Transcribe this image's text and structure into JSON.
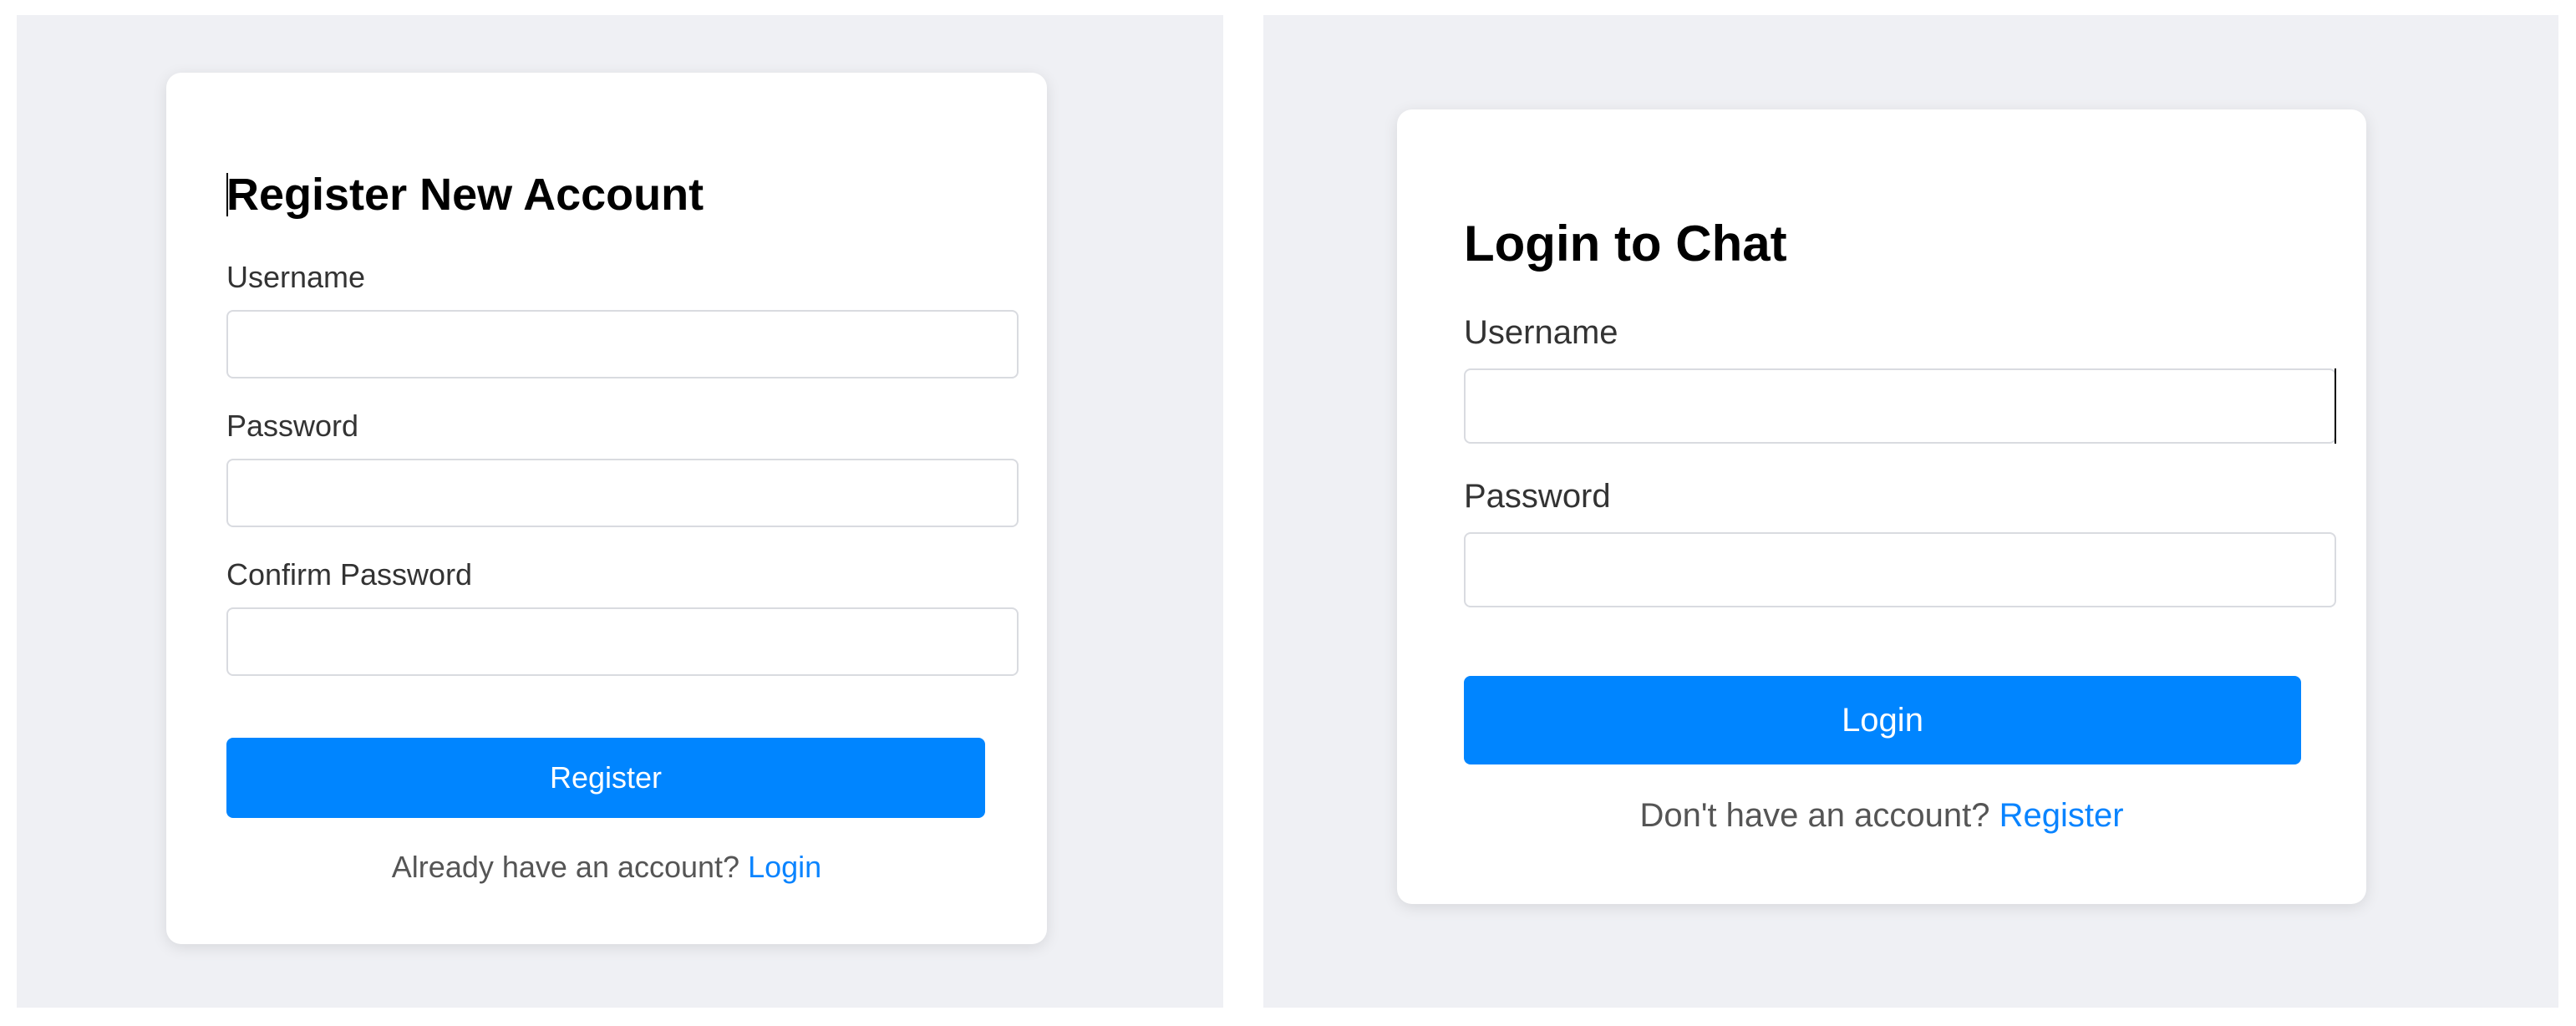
{
  "register_form": {
    "title": "Register New Account",
    "username_label": "Username",
    "username_value": "",
    "password_label": "Password",
    "password_value": "",
    "confirm_password_label": "Confirm Password",
    "confirm_password_value": "",
    "submit_label": "Register",
    "footer_text": "Already have an account?",
    "footer_link": "Login"
  },
  "login_form": {
    "title": "Login to Chat",
    "username_label": "Username",
    "username_value": "",
    "password_label": "Password",
    "password_value": "",
    "submit_label": "Login",
    "footer_text": "Don't have an account?",
    "footer_link": "Register"
  },
  "colors": {
    "panel_background": "#eff0f4",
    "card_background": "#ffffff",
    "primary_button": "#0085ff",
    "link": "#0a84ff"
  }
}
